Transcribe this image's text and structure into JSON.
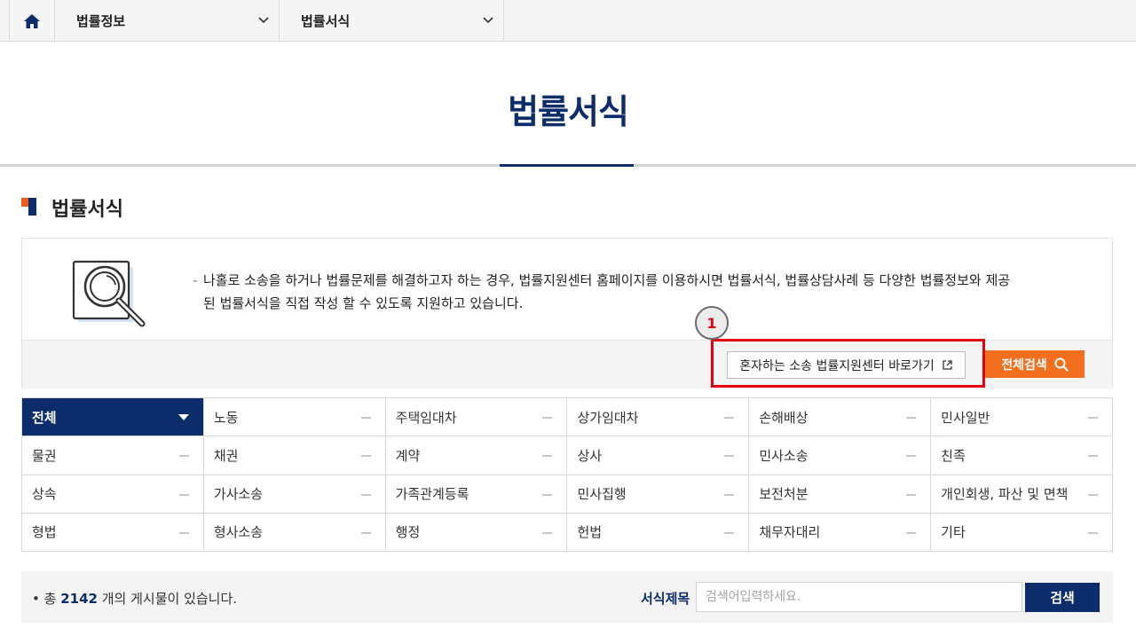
{
  "topnav": {
    "home_icon": "home-icon",
    "menu1": "법률정보",
    "menu2": "법률서식"
  },
  "page": {
    "title": "법률서식",
    "section_title": "법률서식"
  },
  "info": {
    "icon": "document-search-icon",
    "line1": "나홀로 소송을 하거나 법률문제를 해결하고자 하는 경우, 법률지원센터 홈페이지를 이용하시면 법률서식, 법률상담사례 등 다양한 법률정보와 제공",
    "line2": "된 법률서식을 직접 작성 할 수 있도록 지원하고 있습니다.",
    "link_button": "혼자하는 소송 법률지원센터 바로가기",
    "annotation_number": "1",
    "search_all_button": "전체검색"
  },
  "categories": [
    {
      "label": "전체",
      "active": true
    },
    {
      "label": "노동"
    },
    {
      "label": "주택임대차"
    },
    {
      "label": "상가임대차"
    },
    {
      "label": "손해배상"
    },
    {
      "label": "민사일반"
    },
    {
      "label": "물권"
    },
    {
      "label": "채권"
    },
    {
      "label": "계약"
    },
    {
      "label": "상사"
    },
    {
      "label": "민사소송"
    },
    {
      "label": "친족"
    },
    {
      "label": "상속"
    },
    {
      "label": "가사소송"
    },
    {
      "label": "가족관계등록"
    },
    {
      "label": "민사집행"
    },
    {
      "label": "보전처분"
    },
    {
      "label": "개인회생, 파산 및 면책"
    },
    {
      "label": "형법"
    },
    {
      "label": "형사소송"
    },
    {
      "label": "행정"
    },
    {
      "label": "헌법"
    },
    {
      "label": "채무자대리"
    },
    {
      "label": "기타"
    }
  ],
  "search": {
    "count_prefix": "총",
    "count": "2142",
    "count_suffix": "개의 게시물이 있습니다.",
    "label": "서식제목",
    "placeholder": "검색어입력하세요.",
    "button": "검색"
  },
  "colors": {
    "navy": "#0d2c6c",
    "orange": "#f36f1d",
    "annotation_red": "#e60012"
  }
}
